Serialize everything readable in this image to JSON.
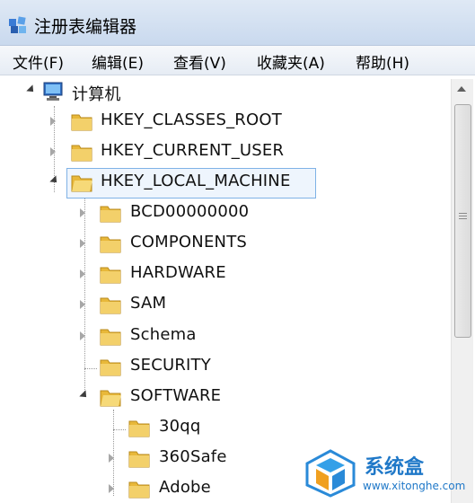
{
  "window": {
    "title": "注册表编辑器"
  },
  "menu": [
    "文件(F)",
    "编辑(E)",
    "查看(V)",
    "收藏夹(A)",
    "帮助(H)"
  ],
  "tree": {
    "root": "计算机",
    "hives": [
      "HKEY_CLASSES_ROOT",
      "HKEY_CURRENT_USER",
      "HKEY_LOCAL_MACHINE"
    ],
    "local_machine_children": [
      "BCD00000000",
      "COMPONENTS",
      "HARDWARE",
      "SAM",
      "Schema",
      "SECURITY",
      "SOFTWARE"
    ],
    "software_children": [
      "30qq",
      "360Safe",
      "Adobe"
    ]
  },
  "watermark": {
    "brand": "系统盒",
    "url": "www.xitonghe.com"
  },
  "colors": {
    "folder": "#e8b83a",
    "selection": "#7fb2e6",
    "brand": "#1f78c8"
  }
}
